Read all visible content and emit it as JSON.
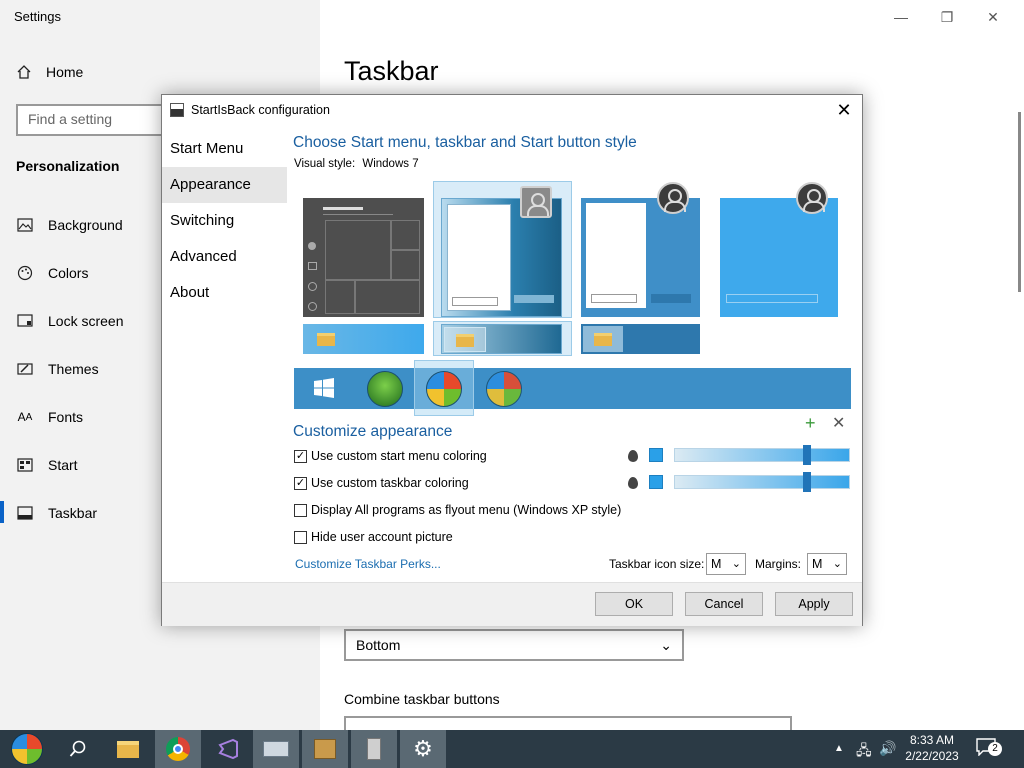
{
  "settings": {
    "window_title": "Settings",
    "home_label": "Home",
    "search_placeholder": "Find a setting",
    "section_heading": "Personalization",
    "nav": [
      {
        "label": "Background",
        "icon": "picture-icon"
      },
      {
        "label": "Colors",
        "icon": "palette-icon"
      },
      {
        "label": "Lock screen",
        "icon": "lock-screen-icon"
      },
      {
        "label": "Themes",
        "icon": "themes-icon"
      },
      {
        "label": "Fonts",
        "icon": "fonts-icon"
      },
      {
        "label": "Start",
        "icon": "start-icon"
      },
      {
        "label": "Taskbar",
        "icon": "taskbar-icon"
      }
    ],
    "active_nav": "Taskbar",
    "page_title": "Taskbar",
    "position_value": "Bottom",
    "combine_label": "Combine taskbar buttons"
  },
  "dialog": {
    "title": "StartIsBack configuration",
    "tabs": [
      "Start Menu",
      "Appearance",
      "Switching",
      "Advanced",
      "About"
    ],
    "active_tab": "Appearance",
    "heading": "Choose Start menu, taskbar and Start button style",
    "visual_style_label": "Visual style:",
    "visual_style_value": "Windows 7",
    "customize_heading": "Customize appearance",
    "options": [
      {
        "label": "Use custom start menu coloring",
        "checked": true
      },
      {
        "label": "Use custom taskbar coloring",
        "checked": true
      },
      {
        "label": "Display All programs as flyout menu (Windows XP style)",
        "checked": false
      },
      {
        "label": "Hide user account picture",
        "checked": false
      }
    ],
    "checkmark": "✓",
    "perks_link": "Customize Taskbar Perks...",
    "icon_size_label": "Taskbar icon size:",
    "icon_size_value": "M",
    "margins_label": "Margins:",
    "margins_value": "M",
    "buttons": {
      "ok": "OK",
      "cancel": "Cancel",
      "apply": "Apply"
    },
    "slider_levels": [
      0.77,
      0.77
    ],
    "accent_color": "#2aa0e8",
    "heading_color": "#1a5fa0"
  },
  "taskbar": {
    "time": "8:33 AM",
    "date": "2/22/2023",
    "notification_count": "2",
    "apps": [
      "start-orb-icon",
      "search-icon",
      "file-explorer-icon",
      "chrome-icon",
      "visual-studio-icon",
      "keyboard-icon",
      "package-icon",
      "server-icon",
      "settings-gear-icon"
    ]
  }
}
